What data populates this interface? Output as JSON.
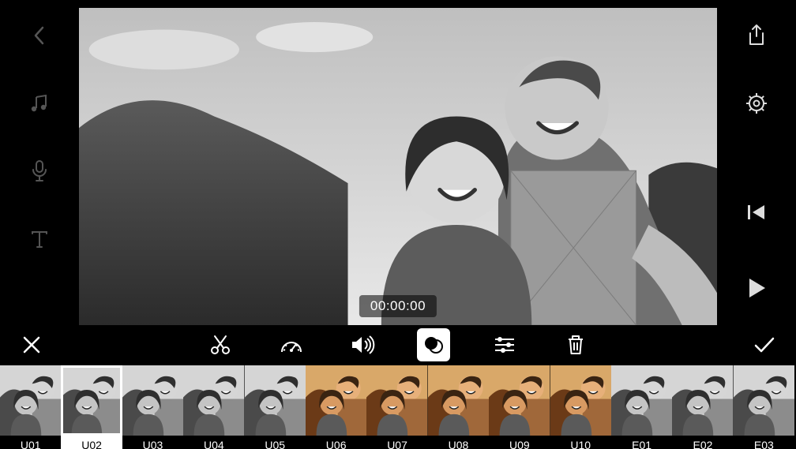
{
  "preview": {
    "timecode": "00:00:00"
  },
  "left_rail": {
    "back": "back",
    "music": "music",
    "voiceover": "voiceover",
    "text": "text"
  },
  "right_rail": {
    "share": "share",
    "settings": "settings",
    "prev": "previous",
    "play": "play"
  },
  "toolbar": {
    "cancel": "cancel",
    "cut": "cut",
    "speed": "speed",
    "volume": "volume",
    "filter": "filter",
    "adjust": "adjust",
    "delete": "delete",
    "confirm": "confirm",
    "active": "filter"
  },
  "filters": [
    {
      "id": "U01",
      "label": "U01",
      "tint": "bw",
      "selected": false
    },
    {
      "id": "U02",
      "label": "U02",
      "tint": "bw",
      "selected": true
    },
    {
      "id": "U03",
      "label": "U03",
      "tint": "bw",
      "selected": false
    },
    {
      "id": "U04",
      "label": "U04",
      "tint": "bw",
      "selected": false
    },
    {
      "id": "U05",
      "label": "U05",
      "tint": "bw",
      "selected": false
    },
    {
      "id": "U06",
      "label": "U06",
      "tint": "warm",
      "selected": false
    },
    {
      "id": "U07",
      "label": "U07",
      "tint": "warm",
      "selected": false
    },
    {
      "id": "U08",
      "label": "U08",
      "tint": "warm",
      "selected": false
    },
    {
      "id": "U09",
      "label": "U09",
      "tint": "warm",
      "selected": false
    },
    {
      "id": "U10",
      "label": "U10",
      "tint": "warm",
      "selected": false
    },
    {
      "id": "E01",
      "label": "E01",
      "tint": "bw",
      "selected": false
    },
    {
      "id": "E02",
      "label": "E02",
      "tint": "bw",
      "selected": false
    },
    {
      "id": "E03",
      "label": "E03",
      "tint": "bw",
      "selected": false
    }
  ]
}
